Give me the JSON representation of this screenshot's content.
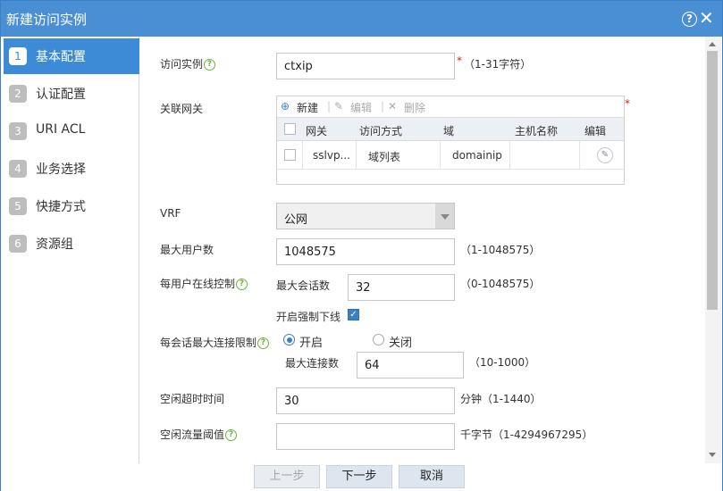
{
  "dialog": {
    "title": "新建访问实例"
  },
  "sidebar": {
    "items": [
      {
        "num": "1",
        "label": "基本配置"
      },
      {
        "num": "2",
        "label": "认证配置"
      },
      {
        "num": "3",
        "label": "URI ACL"
      },
      {
        "num": "4",
        "label": "业务选择"
      },
      {
        "num": "5",
        "label": "快捷方式"
      },
      {
        "num": "6",
        "label": "资源组"
      }
    ]
  },
  "form": {
    "instance": {
      "label": "访问实例",
      "value": "ctxip",
      "hint": "（1-31字符）",
      "required": "*"
    },
    "gateway": {
      "label": "关联网关",
      "required": "*",
      "toolbar": {
        "new": "新建",
        "edit": "编辑",
        "delete": "删除"
      },
      "columns": [
        "网关",
        "访问方式",
        "域",
        "主机名称",
        "编辑"
      ],
      "rows": [
        {
          "gateway": "sslvp...",
          "access": "域列表",
          "domain": "domainip",
          "host": ""
        }
      ]
    },
    "vrf": {
      "label": "VRF",
      "value": "公网"
    },
    "max_users": {
      "label": "最大用户数",
      "value": "1048575",
      "hint": "（1-1048575）"
    },
    "per_user": {
      "label": "每用户在线控制",
      "sub_label": "最大会话数",
      "value": "32",
      "hint": "（0-1048575）",
      "force_label": "开启强制下线",
      "force_checked": true
    },
    "conn_limit": {
      "label": "每会话最大连接限制",
      "on_label": "开启",
      "off_label": "关闭",
      "selected": "开启",
      "sub_label": "最大连接数",
      "value": "64",
      "hint": "（10-1000）"
    },
    "idle_timeout": {
      "label": "空闲超时时间",
      "value": "30",
      "unit_hint": "分钟（1-1440）"
    },
    "idle_traffic": {
      "label": "空闲流量阈值",
      "value": "",
      "unit_hint": "千字节（1-4294967295）"
    }
  },
  "footer": {
    "prev": "上一步",
    "next": "下一步",
    "cancel": "取消"
  },
  "colors": {
    "titlebar": "#4a8fd4",
    "active_step": "#3d8bd6",
    "help_icon": "#6cb33e",
    "required": "#e02020"
  }
}
